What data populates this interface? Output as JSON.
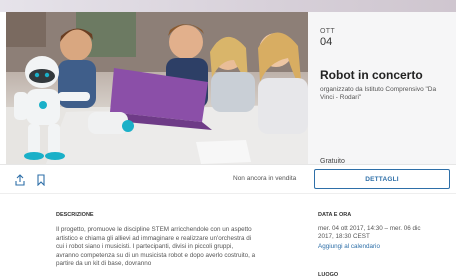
{
  "event": {
    "month": "OTT",
    "day": "04",
    "title": "Robot in concerto",
    "organizer": "organizzato da Istituto Comprensivo \"Da Vinci - Rodari\"",
    "price": "Gratuito"
  },
  "actions": {
    "status": "Non ancora in vendita",
    "details_label": "DETTAGLI"
  },
  "description": {
    "heading": "DESCRIZIONE",
    "body": "Il progetto, promuove le discipline STEM arricchendole con un aspetto artistico e chiama gli allievi ad immaginare e realizzare un'orchestra di cui i robot siano i musicisti. I partecipanti, divisi in piccoli gruppi, avranno competenza su di un musicista robot e dopo averlo costruito, a partire da un kit di base, dovranno"
  },
  "date_time": {
    "heading": "DATA E ORA",
    "range": "mer. 04 ott 2017, 14:30 – mer. 06 dic 2017, 18:30 CEST",
    "calendar_link": "Aggiungi al calendario"
  },
  "location": {
    "heading": "LUOGO"
  },
  "icons": {
    "share": "share-icon",
    "save": "bookmark-icon"
  },
  "colors": {
    "accent": "#2e6fa8",
    "panel_bg": "#f6f6f7",
    "laptop": "#8b4fa8",
    "robot_accent": "#1ab0c8"
  }
}
